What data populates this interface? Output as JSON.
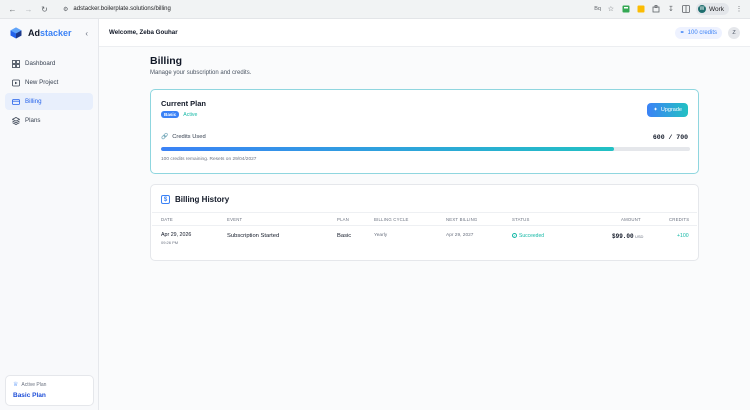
{
  "browser": {
    "url": "adstacker.boilerplate.solutions/billing",
    "profile_name": "Work",
    "profile_initial": "W",
    "ext_label": "Bq"
  },
  "brand": {
    "name_prefix": "Ad",
    "name_suffix": "stacker"
  },
  "sidebar": {
    "items": [
      {
        "label": "Dashboard",
        "icon": "dashboard-icon"
      },
      {
        "label": "New Project",
        "icon": "video-icon"
      },
      {
        "label": "Billing",
        "icon": "credit-card-icon",
        "active": true
      },
      {
        "label": "Plans",
        "icon": "layers-icon"
      }
    ],
    "plan_card": {
      "label": "Active Plan",
      "value": "Basic Plan"
    }
  },
  "topbar": {
    "welcome": "Welcome, Zeba Gouhar",
    "credits": "100 credits",
    "user_initial": "Z"
  },
  "page": {
    "title": "Billing",
    "subtitle": "Manage your subscription and credits."
  },
  "current_plan": {
    "title": "Current Plan",
    "badge": "Basic",
    "status": "Active",
    "upgrade_label": "Upgrade",
    "credits_label": "Credits Used",
    "credits_value": "600 / 700",
    "progress_fraction": 0.857,
    "remaining_text": "100 credits remaining. Resets on 29/04/2027"
  },
  "billing_history": {
    "title": "Billing History",
    "columns": [
      "Date",
      "Event",
      "Plan",
      "Billing Cycle",
      "Next Billing",
      "Status",
      "Amount",
      "Credits"
    ],
    "rows": [
      {
        "date": "Apr 29, 2026",
        "time": "09:26 PM",
        "event": "Subscription Started",
        "plan": "Basic",
        "cycle": "Yearly",
        "next_billing": "Apr 29, 2027",
        "status": "Succeeded",
        "amount": "$99.00",
        "currency": "USD",
        "credits": "+100"
      }
    ]
  },
  "colors": {
    "accent_blue": "#3b82f6",
    "accent_teal": "#14b8a6"
  }
}
